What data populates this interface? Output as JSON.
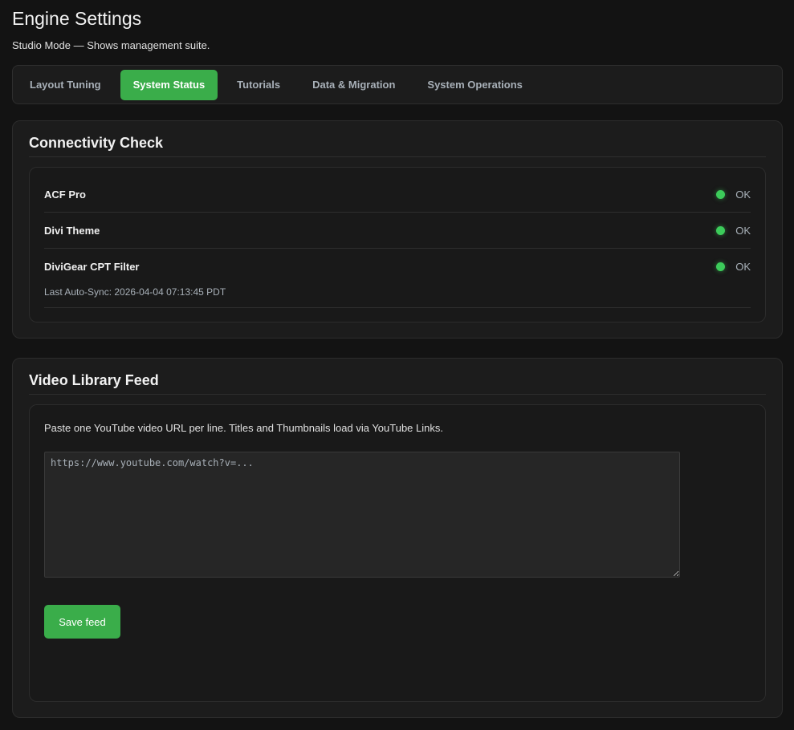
{
  "header": {
    "title": "Engine Settings",
    "subtitle": "Studio Mode — Shows management suite."
  },
  "tabs": [
    {
      "label": "Layout Tuning",
      "active": false
    },
    {
      "label": "System Status",
      "active": true
    },
    {
      "label": "Tutorials",
      "active": false
    },
    {
      "label": "Data & Migration",
      "active": false
    },
    {
      "label": "System Operations",
      "active": false
    }
  ],
  "connectivity": {
    "title": "Connectivity Check",
    "items": [
      {
        "name": "ACF Pro",
        "status": "OK"
      },
      {
        "name": "Divi Theme",
        "status": "OK"
      },
      {
        "name": "DiviGear CPT Filter",
        "status": "OK",
        "note": "Last Auto-Sync: 2026-04-04 07:13:45 PDT"
      }
    ]
  },
  "video_feed": {
    "title": "Video Library Feed",
    "help_text": "Paste one YouTube video URL per line. Titles and Thumbnails load via YouTube Links.",
    "textarea_value": "",
    "textarea_placeholder": "https://www.youtube.com/watch?v=...",
    "save_label": "Save feed"
  },
  "colors": {
    "accent": "#3aad4a",
    "status_ok": "#3ccb5a",
    "background": "#131313",
    "card": "#1c1c1c"
  }
}
